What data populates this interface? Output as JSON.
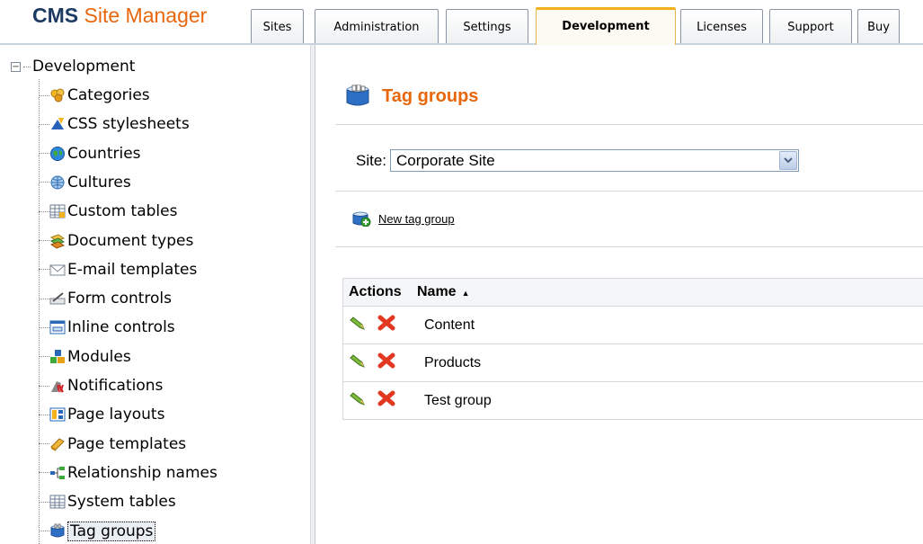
{
  "app": {
    "brand_primary": "CMS",
    "brand_secondary": "Site Manager",
    "accent_color": "#e8670c",
    "brand_color": "#1d3a63"
  },
  "tabs": [
    {
      "label": "Sites",
      "active": false
    },
    {
      "label": "Administration",
      "active": false
    },
    {
      "label": "Settings",
      "active": false
    },
    {
      "label": "Development",
      "active": true
    },
    {
      "label": "Licenses",
      "active": false
    },
    {
      "label": "Support",
      "active": false
    },
    {
      "label": "Buy",
      "active": false
    }
  ],
  "tree": {
    "root_label": "Development",
    "toggle_symbol": "−",
    "items": [
      {
        "label": "Categories",
        "icon": "categories-icon"
      },
      {
        "label": "CSS stylesheets",
        "icon": "css-icon"
      },
      {
        "label": "Countries",
        "icon": "globe-icon"
      },
      {
        "label": "Cultures",
        "icon": "cultures-icon"
      },
      {
        "label": "Custom tables",
        "icon": "table-icon"
      },
      {
        "label": "Document types",
        "icon": "document-types-icon"
      },
      {
        "label": "E-mail templates",
        "icon": "email-icon"
      },
      {
        "label": "Form controls",
        "icon": "form-controls-icon"
      },
      {
        "label": "Inline controls",
        "icon": "inline-controls-icon"
      },
      {
        "label": "Modules",
        "icon": "modules-icon"
      },
      {
        "label": "Notifications",
        "icon": "notifications-icon"
      },
      {
        "label": "Page layouts",
        "icon": "page-layouts-icon"
      },
      {
        "label": "Page templates",
        "icon": "page-templates-icon"
      },
      {
        "label": "Relationship names",
        "icon": "relationship-icon"
      },
      {
        "label": "System tables",
        "icon": "system-tables-icon"
      },
      {
        "label": "Tag groups",
        "icon": "tag-groups-icon",
        "selected": true
      }
    ]
  },
  "main": {
    "title": "Tag groups",
    "site_label": "Site:",
    "site_value": "Corporate Site",
    "new_link": "New tag group",
    "grid": {
      "col_actions": "Actions",
      "col_name": "Name",
      "sort_indicator": "▲",
      "rows": [
        {
          "name": "Content"
        },
        {
          "name": "Products"
        },
        {
          "name": "Test group"
        }
      ]
    }
  }
}
